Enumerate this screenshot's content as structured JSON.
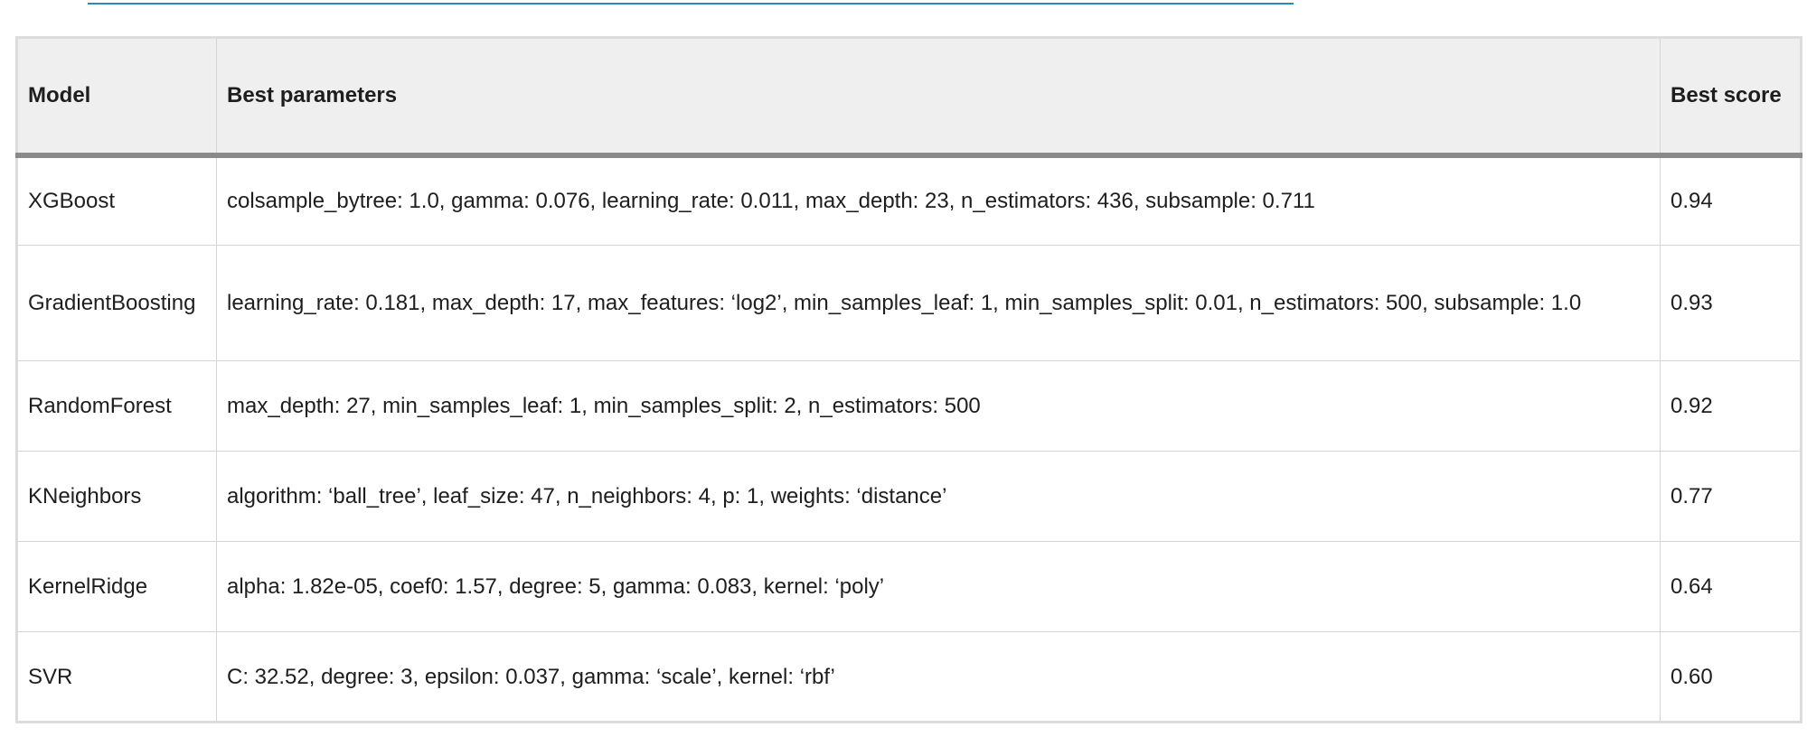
{
  "table": {
    "headers": [
      "Model",
      "Best parameters",
      "Best score"
    ],
    "rows": [
      {
        "model": "XGBoost",
        "params": "colsample_bytree: 1.0, gamma: 0.076, learning_rate: 0.011, max_depth: 23, n_estimators: 436, subsample: 0.711",
        "score": "0.94"
      },
      {
        "model": "GradientBoosting",
        "params": "learning_rate: 0.181, max_depth: 17, max_features: ‘log2’, min_samples_leaf: 1, min_samples_split: 0.01, n_estimators: 500, subsample: 1.0",
        "score": "0.93"
      },
      {
        "model": "RandomForest",
        "params": "max_depth: 27, min_samples_leaf: 1, min_samples_split: 2, n_estimators: 500",
        "score": "0.92"
      },
      {
        "model": "KNeighbors",
        "params": "algorithm: ‘ball_tree’, leaf_size: 47, n_neighbors: 4, p: 1, weights: ‘distance’",
        "score": "0.77"
      },
      {
        "model": "KernelRidge",
        "params": "alpha: 1.82e-05, coef0: 1.57, degree: 5, gamma: 0.083, kernel: ‘poly’",
        "score": "0.64"
      },
      {
        "model": "SVR",
        "params": "C: 32.52, degree: 3, epsilon: 0.037, gamma: ‘scale’, kernel: ‘rbf’",
        "score": "0.60"
      }
    ]
  },
  "colors": {
    "header_bg": "#efefef",
    "link": "#2a8bbd",
    "border": "#d4d4d4",
    "header_rule": "#8a8a8a"
  }
}
